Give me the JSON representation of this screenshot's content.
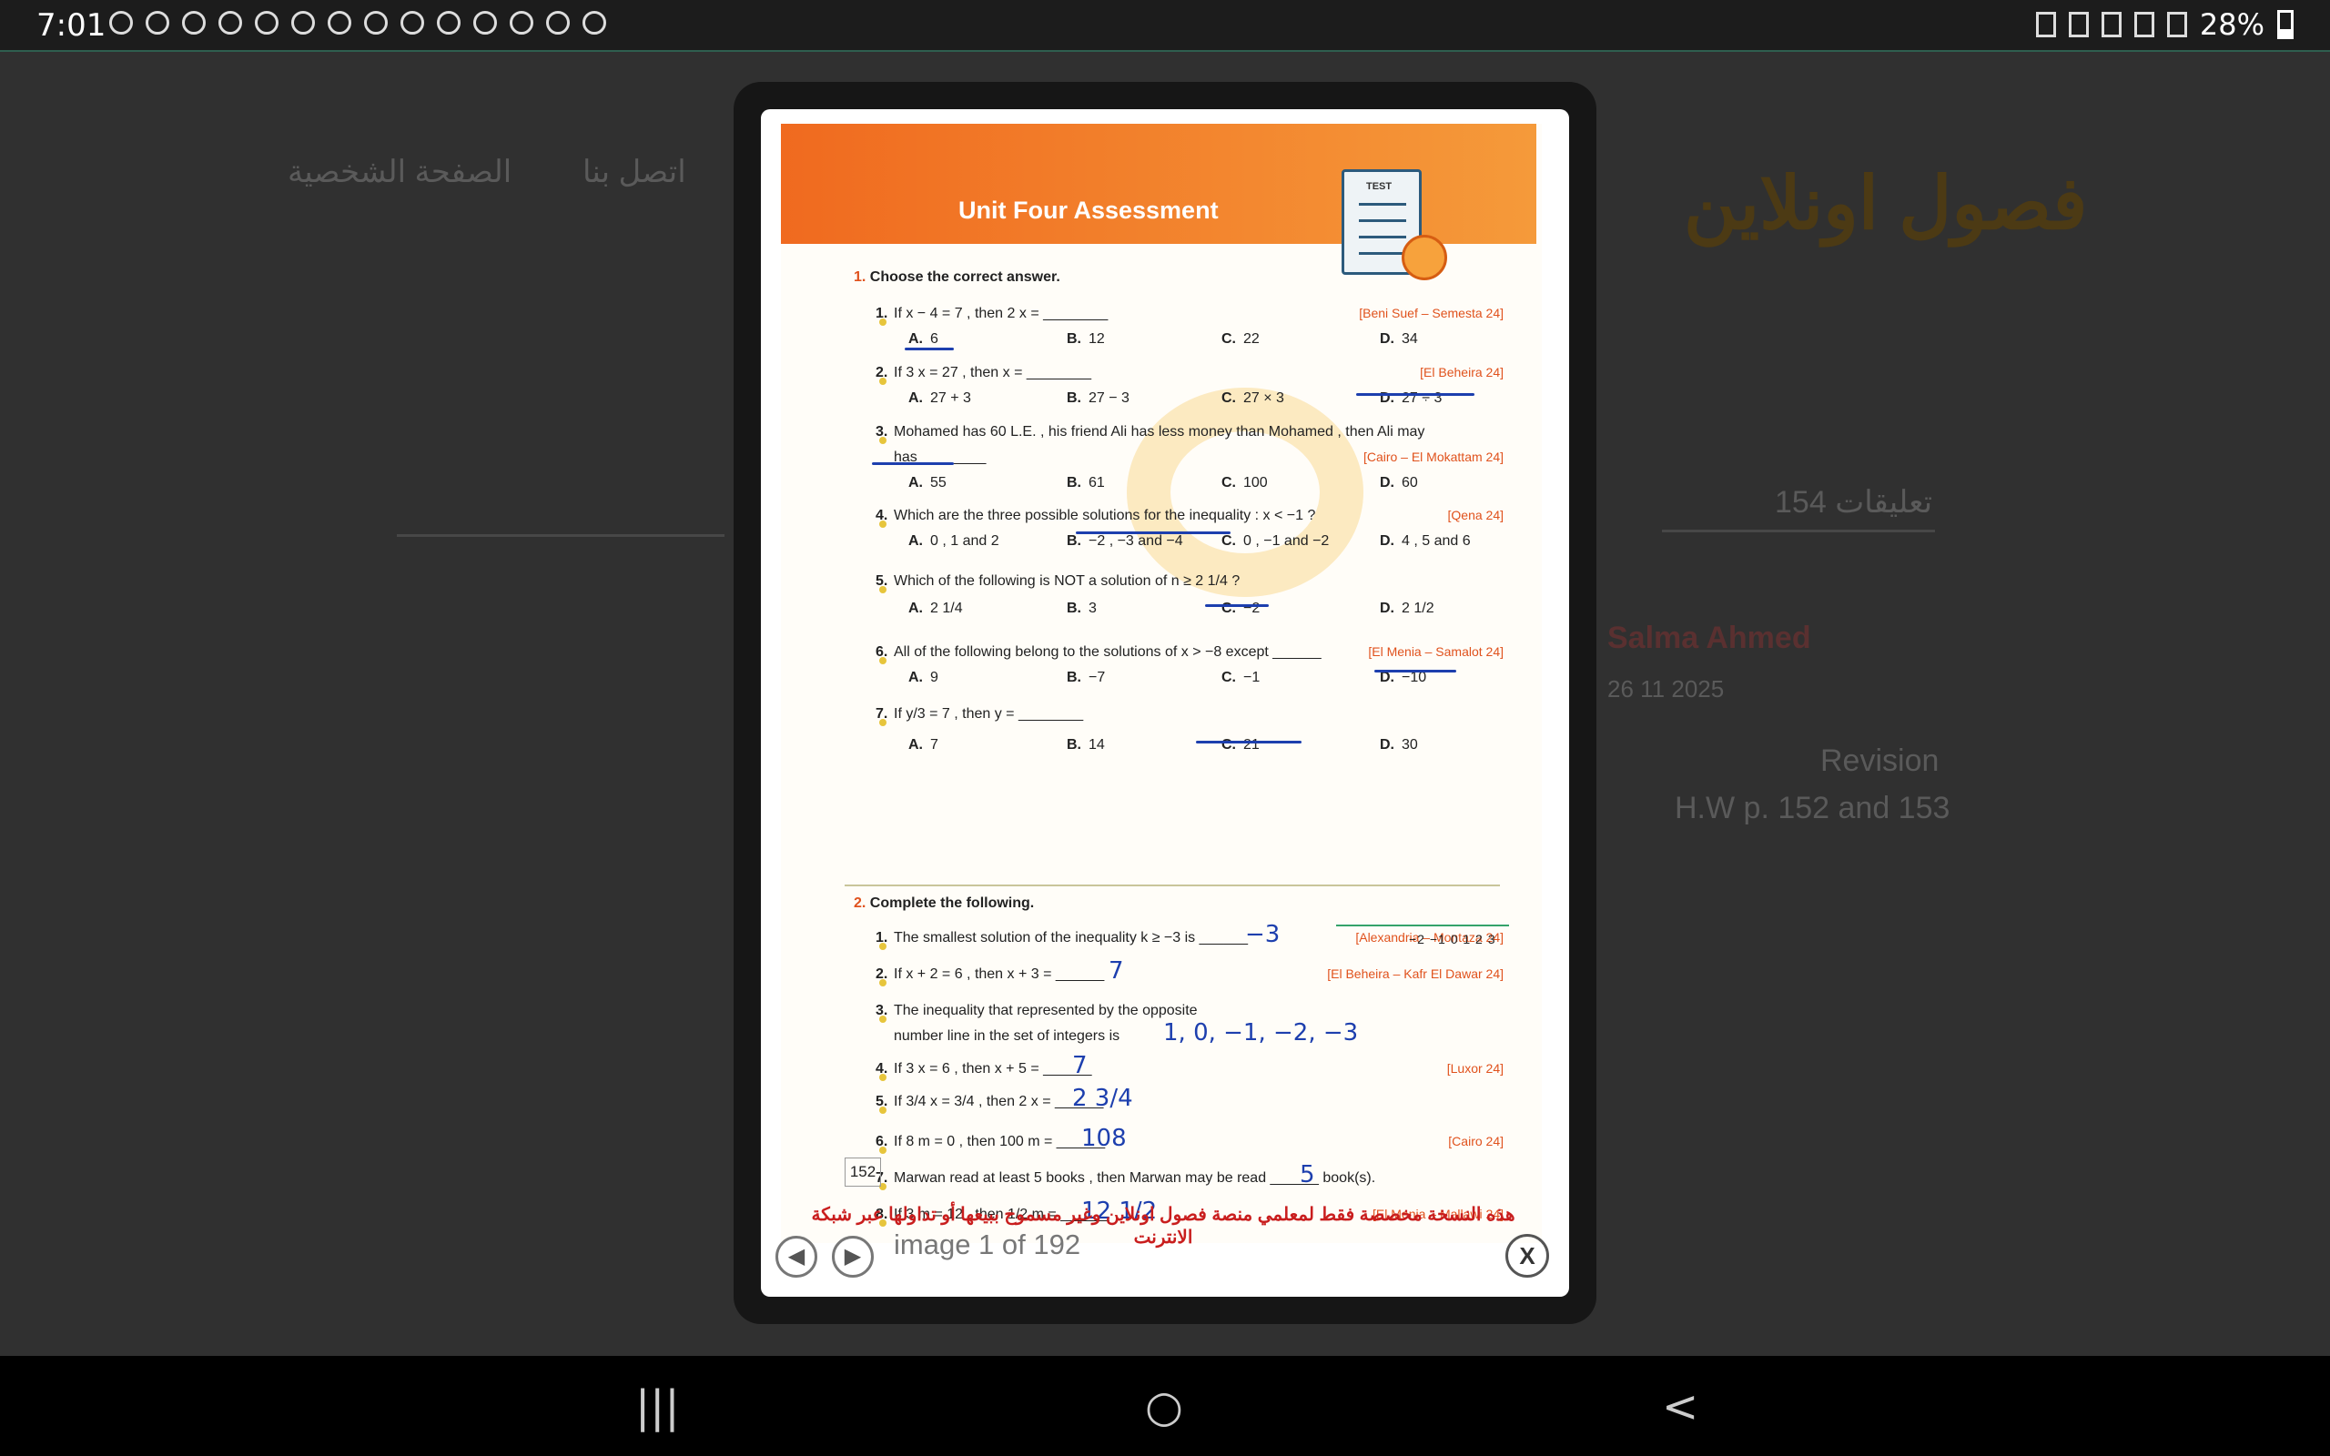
{
  "status": {
    "time": "7:01",
    "battery": "28%"
  },
  "background": {
    "nav_profile": "الصفحة الشخصية",
    "nav_contact": "اتصل بنا",
    "logo_text": "فصول اونلاين",
    "comments": "154 تعليقات",
    "user_name": "Salma Ahmed",
    "date": "26 11 2025",
    "revision": "Revision",
    "homework": "H.W p. 152 and 153"
  },
  "worksheet": {
    "title": "Unit Four Assessment",
    "test_label": "TEST",
    "section1_num": "1.",
    "section1_label": "Choose the correct answer.",
    "section2_num": "2.",
    "section2_label": "Complete the following.",
    "page_number": "152",
    "footer_arabic": "هذه النسخة مخصصة فقط لمعلمي منصة فصول اونلاين وغير مسموح ببيعها أو تداولها عبر شبكة الانترنت",
    "questions": [
      {
        "num": "1.",
        "text": "If x − 4 = 7 , then 2 x = ________",
        "source": "[Beni Suef – Semesta 24]",
        "a": "6",
        "b": "12",
        "c": "22",
        "d": "34"
      },
      {
        "num": "2.",
        "text": "If 3 x = 27 , then x = ________",
        "source": "[El Beheira 24]",
        "a": "27 + 3",
        "b": "27 − 3",
        "c": "27 × 3",
        "d": "27 ÷ 3"
      },
      {
        "num": "3.",
        "text": "Mohamed has 60 L.E. , his friend Ali has less money than Mohamed , then Ali may",
        "text2": "has ________",
        "source": "[Cairo – El Mokattam 24]",
        "a": "55",
        "b": "61",
        "c": "100",
        "d": "60"
      },
      {
        "num": "4.",
        "text": "Which are the three possible solutions for the inequality : x < −1 ?",
        "source": "[Qena 24]",
        "a": "0 , 1 and 2",
        "b": "−2 , −3 and −4",
        "c": "0 , −1 and −2",
        "d": "4 , 5 and 6"
      },
      {
        "num": "5.",
        "text": "Which of the following is NOT a solution of n ≥ 2 1/4 ?",
        "source": "",
        "a": "2 1/4",
        "b": "3",
        "c": "−2",
        "d": "2 1/2"
      },
      {
        "num": "6.",
        "text": "All of the following belong to the solutions of x > −8 except ______",
        "source": "[El Menia – Samalot 24]",
        "a": "9",
        "b": "−7",
        "c": "−1",
        "d": "−10"
      },
      {
        "num": "7.",
        "text": "If y/3 = 7 , then y = ________",
        "source": "",
        "a": "7",
        "b": "14",
        "c": "21",
        "d": "30"
      }
    ],
    "completions": [
      {
        "num": "1.",
        "text": "The smallest solution of the inequality k ≥ −3 is ______",
        "source": "[Alexandria – Montaza 24]",
        "answer": "−3"
      },
      {
        "num": "2.",
        "text": "If x + 2 = 6 , then x + 3 = ______",
        "source": "[El Beheira – Kafr El Dawar 24]",
        "answer": "7"
      },
      {
        "num": "3.",
        "text": "The inequality that represented  by the opposite",
        "text2": "number line in the set of integers is",
        "source": "",
        "answer": "1, 0, −1, −2, −3"
      },
      {
        "num": "4.",
        "text": "If 3 x = 6 , then x + 5 = ______",
        "source": "[Luxor 24]",
        "answer": "7"
      },
      {
        "num": "5.",
        "text": "If 3/4 x = 3/4 , then 2 x = ______",
        "source": "",
        "answer": "2 3/4"
      },
      {
        "num": "6.",
        "text": "If 8 m = 0 , then 100 m = ______",
        "source": "[Cairo 24]",
        "answer": "108"
      },
      {
        "num": "7.",
        "text": "Marwan read at least 5 books , then Marwan may be read ______ book(s).",
        "source": "",
        "answer": "5"
      },
      {
        "num": "8.",
        "text": "If 3 m = 12 , then 1/2 m = ______",
        "source": "[El Menia – Mallawi 24]",
        "answer": "12 1/2"
      }
    ],
    "numline_labels": "−2  −1  0  1  2  3"
  },
  "viewer": {
    "counter": "image 1 of 192",
    "prev": "◀",
    "next": "▶",
    "close": "X"
  },
  "navbar": {
    "recents": "|||",
    "home": "○",
    "back": "<"
  }
}
